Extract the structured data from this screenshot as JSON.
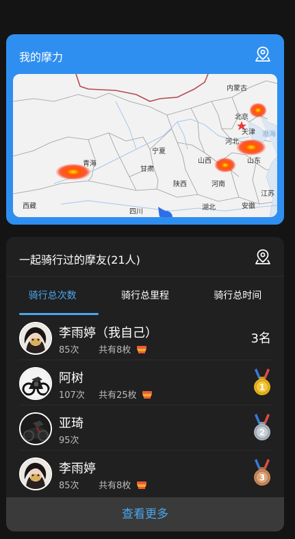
{
  "moto_card": {
    "title": "我的摩力",
    "map_labels": {
      "nei_menggu": "内蒙古",
      "beijing": "北京",
      "tianjin": "天津",
      "bohai": "渤海",
      "hebei": "河北",
      "ningxia": "宁夏",
      "qinghai": "青海",
      "gansu": "甘肃",
      "shanxi": "山西",
      "shandong": "山东",
      "shaanxi": "陕西",
      "henan": "河南",
      "jiangsu": "江苏",
      "xizang": "西藏",
      "sichuan": "四川",
      "hubei": "湖北",
      "anhui": "安徽"
    }
  },
  "friends_card": {
    "title": "一起骑行过的摩友(21人)",
    "tabs": [
      "骑行总次数",
      "骑行总里程",
      "骑行总时间"
    ],
    "rows": [
      {
        "name": "李雨婷（我自己）",
        "count": "85次",
        "badges": "共有8枚",
        "rank": "3名"
      },
      {
        "name": "阿树",
        "count": "107次",
        "badges": "共有25枚",
        "rank": "1"
      },
      {
        "name": "亚琦",
        "count": "95次",
        "badges": "",
        "rank": "2"
      },
      {
        "name": "李雨婷",
        "count": "85次",
        "badges": "共有8枚",
        "rank": "3"
      }
    ],
    "more_label": "查看更多"
  },
  "colors": {
    "accent": "#4aa8f0",
    "card_blue": "#2e8ff0",
    "gold": "#e8b21a",
    "silver": "#a9b4bf",
    "bronze": "#c9895a"
  }
}
